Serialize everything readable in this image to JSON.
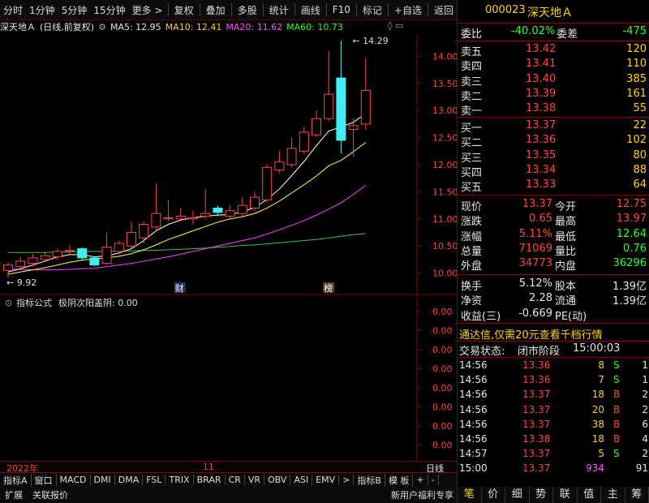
{
  "toolbar": {
    "left": [
      "分时",
      "1分钟",
      "5分钟",
      "15分钟",
      "更多 >"
    ],
    "right": [
      "复权",
      "叠加",
      "多股",
      "统计",
      "画线",
      "F10",
      "标记",
      "+自选",
      "返回"
    ]
  },
  "info": {
    "stock": "深天地Ａ",
    "mode": "(日线,前复权)",
    "ma5": "MA5: 12.95",
    "ma10": "MA10: 12.41",
    "ma20": "MA20: 11.62",
    "ma60": "MA60: 10.73"
  },
  "yaxis": [
    "14.00",
    "13.50",
    "13.00",
    "12.50",
    "12.00",
    "11.50",
    "11.00",
    "10.50",
    "10.00"
  ],
  "annotations": {
    "high": "14.29",
    "low": "9.92",
    "cai": "财",
    "bang": "榜"
  },
  "indicator": {
    "title": "指标公式",
    "formula": "极阴次阳盖阴: 0.00",
    "ticks": [
      "0.00",
      "0.00",
      "0.00",
      "0.00",
      "0.00",
      "0.00",
      "0.00",
      "0.00"
    ]
  },
  "xaxis": {
    "year": "2022年",
    "month": "11",
    "period": "日线"
  },
  "tabs": [
    "指标A",
    "窗口",
    "MACD",
    "DMI",
    "DMA",
    "FSL",
    "TRIX",
    "BRAR",
    "CR",
    "VR",
    "OBV",
    "ASI",
    "EMV",
    ">",
    "指标B",
    "模 板",
    "+",
    "-"
  ],
  "status": {
    "left1": "扩展",
    "left2": "关联报价",
    "right": "新用户福利专享"
  },
  "quote": {
    "code": "000023",
    "name": "深天地Ａ",
    "weibi_label": "委比",
    "weibi": "-40.02%",
    "weicha_label": "委差",
    "weicha": "-475",
    "asks": [
      {
        "label": "卖五",
        "price": "13.42",
        "vol": "120"
      },
      {
        "label": "卖四",
        "price": "13.41",
        "vol": "110"
      },
      {
        "label": "卖三",
        "price": "13.40",
        "vol": "385"
      },
      {
        "label": "卖二",
        "price": "13.39",
        "vol": "161"
      },
      {
        "label": "卖一",
        "price": "13.38",
        "vol": "55"
      }
    ],
    "bids": [
      {
        "label": "买一",
        "price": "13.37",
        "vol": "22"
      },
      {
        "label": "买二",
        "price": "13.36",
        "vol": "102"
      },
      {
        "label": "买三",
        "price": "13.35",
        "vol": "80"
      },
      {
        "label": "买四",
        "price": "13.34",
        "vol": "88"
      },
      {
        "label": "买五",
        "price": "13.33",
        "vol": "64"
      }
    ],
    "stats": [
      {
        "l1": "现价",
        "v1": "13.37",
        "l2": "今开",
        "v2": "12.75"
      },
      {
        "l1": "涨跌",
        "v1": "0.65",
        "l2": "最高",
        "v2": "13.97"
      },
      {
        "l1": "涨幅",
        "v1": "5.11%",
        "l2": "最低",
        "v2": "12.64"
      },
      {
        "l1": "总量",
        "v1": "71069",
        "l2": "量比",
        "v2": "0.76"
      },
      {
        "l1": "外盘",
        "v1": "34773",
        "l2": "内盘",
        "v2": "36296"
      }
    ],
    "stats2": [
      {
        "l1": "换手",
        "v1": "5.12%",
        "l2": "股本",
        "v2": "1.39亿"
      },
      {
        "l1": "净资",
        "v1": "2.28",
        "l2": "流通",
        "v2": "1.39亿"
      },
      {
        "l1": "收益(三)",
        "v1": "-0.669",
        "l2": "PE(动)",
        "v2": ""
      }
    ],
    "promo": "通达信,仅需20元查看千档行情",
    "trade_state_label": "交易状态:",
    "trade_state": "闭市阶段",
    "trade_time": "15:00:03",
    "ticks": [
      {
        "t": "14:56",
        "p": "13.36",
        "v": "8",
        "d": "S",
        "n": "1"
      },
      {
        "t": "14:56",
        "p": "13.36",
        "v": "7",
        "d": "S",
        "n": "1"
      },
      {
        "t": "14:56",
        "p": "13.37",
        "v": "18",
        "d": "B",
        "n": "2"
      },
      {
        "t": "14:56",
        "p": "13.37",
        "v": "20",
        "d": "B",
        "n": "2"
      },
      {
        "t": "14:56",
        "p": "13.37",
        "v": "38",
        "d": "B",
        "n": "6"
      },
      {
        "t": "14:56",
        "p": "13.38",
        "v": "18",
        "d": "B",
        "n": "4"
      },
      {
        "t": "14:57",
        "p": "13.37",
        "v": "5",
        "d": "S",
        "n": "2"
      },
      {
        "t": "15:00",
        "p": "13.37",
        "v": "934",
        "d": "",
        "n": "91"
      }
    ],
    "bottom_tabs": [
      "笔",
      "价",
      "细",
      "势",
      "联",
      "值",
      "主",
      "筹"
    ]
  },
  "colors": {
    "up": "#ff4545",
    "down": "#40f0f0",
    "ma5": "#ffffff",
    "ma10": "#ffff40",
    "ma20": "#ff40ff",
    "ma60": "#40c040"
  },
  "candles": [
    {
      "o": 10.05,
      "c": 10.15,
      "h": 10.2,
      "l": 9.92
    },
    {
      "o": 10.12,
      "c": 10.22,
      "h": 10.3,
      "l": 10.08
    },
    {
      "o": 10.18,
      "c": 10.28,
      "h": 10.35,
      "l": 10.12
    },
    {
      "o": 10.25,
      "c": 10.32,
      "h": 10.4,
      "l": 10.2
    },
    {
      "o": 10.3,
      "c": 10.4,
      "h": 10.45,
      "l": 10.25
    },
    {
      "o": 10.4,
      "c": 10.42,
      "h": 10.52,
      "l": 10.35
    },
    {
      "o": 10.45,
      "c": 10.28,
      "h": 10.48,
      "l": 10.22
    },
    {
      "o": 10.28,
      "c": 10.15,
      "h": 10.3,
      "l": 10.12
    },
    {
      "o": 10.18,
      "c": 10.48,
      "h": 10.75,
      "l": 10.15
    },
    {
      "o": 10.4,
      "c": 10.55,
      "h": 10.6,
      "l": 10.35
    },
    {
      "o": 10.5,
      "c": 10.75,
      "h": 10.95,
      "l": 10.45
    },
    {
      "o": 10.65,
      "c": 10.9,
      "h": 10.95,
      "l": 10.55
    },
    {
      "o": 10.85,
      "c": 11.1,
      "h": 11.65,
      "l": 10.8
    },
    {
      "o": 11.0,
      "c": 11.02,
      "h": 11.35,
      "l": 10.95
    },
    {
      "o": 11.0,
      "c": 11.05,
      "h": 11.2,
      "l": 10.95
    },
    {
      "o": 11.0,
      "c": 11.02,
      "h": 11.15,
      "l": 10.9
    },
    {
      "o": 11.05,
      "c": 11.1,
      "h": 11.55,
      "l": 11.0
    },
    {
      "o": 11.2,
      "c": 11.12,
      "h": 11.25,
      "l": 11.05
    },
    {
      "o": 11.05,
      "c": 11.15,
      "h": 11.25,
      "l": 11.0
    },
    {
      "o": 11.1,
      "c": 11.25,
      "h": 11.4,
      "l": 11.05
    },
    {
      "o": 11.2,
      "c": 11.4,
      "h": 11.5,
      "l": 11.15
    },
    {
      "o": 11.35,
      "c": 11.95,
      "h": 12.0,
      "l": 11.3
    },
    {
      "o": 11.9,
      "c": 12.05,
      "h": 12.25,
      "l": 11.85
    },
    {
      "o": 12.0,
      "c": 12.3,
      "h": 12.5,
      "l": 11.95
    },
    {
      "o": 12.25,
      "c": 12.6,
      "h": 12.7,
      "l": 12.2
    },
    {
      "o": 12.55,
      "c": 12.85,
      "h": 13.0,
      "l": 12.5
    },
    {
      "o": 12.85,
      "c": 13.3,
      "h": 14.1,
      "l": 12.8
    },
    {
      "o": 13.6,
      "c": 12.45,
      "h": 14.29,
      "l": 12.2
    },
    {
      "o": 12.65,
      "c": 12.72,
      "h": 12.85,
      "l": 12.15
    },
    {
      "o": 12.75,
      "c": 13.37,
      "h": 13.97,
      "l": 12.64
    }
  ],
  "ma_lines": {
    "ma5": [
      10.02,
      10.08,
      10.15,
      10.22,
      10.3,
      10.34,
      10.34,
      10.3,
      10.32,
      10.37,
      10.45,
      10.6,
      10.78,
      10.9,
      10.98,
      11.02,
      11.05,
      11.07,
      11.08,
      11.13,
      11.21,
      11.36,
      11.55,
      11.8,
      12.06,
      12.35,
      12.62,
      12.7,
      12.78,
      12.95
    ],
    "ma10": [
      9.98,
      10.02,
      10.06,
      10.1,
      10.15,
      10.2,
      10.24,
      10.26,
      10.28,
      10.31,
      10.36,
      10.43,
      10.52,
      10.62,
      10.7,
      10.78,
      10.86,
      10.94,
      11.0,
      11.04,
      11.1,
      11.2,
      11.33,
      11.48,
      11.63,
      11.79,
      11.98,
      12.08,
      12.24,
      12.41
    ],
    "ma20": [
      10.08,
      10.07,
      10.06,
      10.06,
      10.06,
      10.07,
      10.08,
      10.09,
      10.12,
      10.15,
      10.18,
      10.22,
      10.26,
      10.3,
      10.35,
      10.4,
      10.45,
      10.5,
      10.55,
      10.6,
      10.65,
      10.72,
      10.8,
      10.88,
      10.97,
      11.07,
      11.18,
      11.3,
      11.45,
      11.62
    ],
    "ma60": [
      10.38,
      10.38,
      10.38,
      10.38,
      10.39,
      10.39,
      10.4,
      10.4,
      10.4,
      10.41,
      10.41,
      10.42,
      10.42,
      10.43,
      10.44,
      10.45,
      10.46,
      10.48,
      10.49,
      10.51,
      10.52,
      10.54,
      10.56,
      10.58,
      10.6,
      10.62,
      10.65,
      10.68,
      10.71,
      10.73
    ]
  }
}
